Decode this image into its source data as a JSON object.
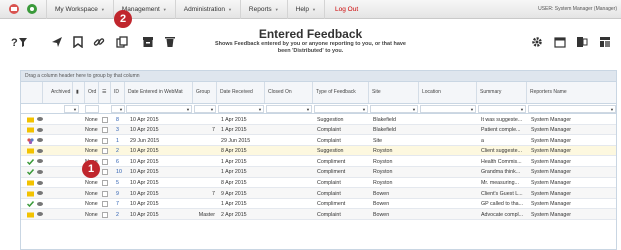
{
  "menubar": {
    "items": [
      {
        "label": "My Workspace"
      },
      {
        "label": "Management"
      },
      {
        "label": "Administration"
      },
      {
        "label": "Reports"
      },
      {
        "label": "Help"
      }
    ],
    "logout": "Log Out",
    "user": "USER: System Manager (Manager)"
  },
  "page": {
    "title": "Entered Feedback",
    "subtitle_line1": "Shows Feedback entered by you or anyone reporting to you, or that have",
    "subtitle_line2": "been 'Distributed' to you."
  },
  "badges": {
    "one": "1",
    "two": "2"
  },
  "grid": {
    "group_tip": "Drag a column header here to group by that column",
    "columns": [
      "Archived",
      "Ord",
      "ID",
      "Date Entered in WebMat",
      "Group",
      "Date Received",
      "Closed On",
      "Type of Feedback",
      "Site",
      "Location",
      "Summary",
      "Reporters Name"
    ],
    "rows": [
      {
        "flag": "yellow",
        "ord": "None",
        "id": "8",
        "entered": "10 Apr 2015",
        "group": "",
        "received": "1 Apr 2015",
        "type": "Suggestion",
        "site": "Blakefield",
        "summary": "It was suggeste...",
        "reporter": "System Manager"
      },
      {
        "flag": "yellow",
        "ord": "None",
        "id": "3",
        "entered": "10 Apr 2015",
        "group": "7",
        "received": "1 Apr 2015",
        "type": "Complaint",
        "site": "Blakefield",
        "summary": "Patient comple...",
        "reporter": "System Manager"
      },
      {
        "flag": "multi",
        "ord": "None",
        "id": "1",
        "entered": "29 Jun 2015",
        "group": "",
        "received": "29 Jun 2015",
        "type": "Complaint",
        "site": "Site",
        "summary": "a",
        "reporter": "System Manager"
      },
      {
        "flag": "yellow",
        "ord": "None",
        "id": "2",
        "entered": "10 Apr 2015",
        "group": "",
        "received": "8 Apr 2015",
        "type": "Suggestion",
        "site": "Royston",
        "summary": "Client suggeste...",
        "reporter": "System Manager"
      },
      {
        "flag": "check",
        "ord": "None",
        "id": "6",
        "entered": "10 Apr 2015",
        "group": "",
        "received": "1 Apr 2015",
        "type": "Compliment",
        "site": "Royston",
        "summary": "Health Commis...",
        "reporter": "System Manager"
      },
      {
        "flag": "check",
        "ord": "None",
        "id": "10",
        "entered": "10 Apr 2015",
        "group": "",
        "received": "1 Apr 2015",
        "type": "Compliment",
        "site": "Royston",
        "summary": "Grandma think...",
        "reporter": "System Manager"
      },
      {
        "flag": "yellow",
        "ord": "None",
        "id": "5",
        "entered": "10 Apr 2015",
        "group": "",
        "received": "8 Apr 2015",
        "type": "Complaint",
        "site": "Royston",
        "summary": "Mr. measuring...",
        "reporter": "System Manager"
      },
      {
        "flag": "yellow",
        "ord": "None",
        "id": "9",
        "entered": "10 Apr 2015",
        "group": "7",
        "received": "9 Apr 2015",
        "type": "Complaint",
        "site": "Bowen",
        "summary": "Client's Guest L...",
        "reporter": "System Manager"
      },
      {
        "flag": "check",
        "ord": "None",
        "id": "7",
        "entered": "10 Apr 2015",
        "group": "",
        "received": "1 Apr 2015",
        "type": "Compliment",
        "site": "Bowen",
        "summary": "GP called to tha...",
        "reporter": "System Manager"
      },
      {
        "flag": "yellow",
        "ord": "None",
        "id": "2",
        "entered": "10 Apr 2015",
        "group": "Master",
        "received": "2 Apr 2015",
        "type": "Complaint",
        "site": "Bowen",
        "summary": "Advocate compl...",
        "reporter": "System Manager"
      }
    ]
  },
  "colors": {
    "accent": "#2a5db0",
    "badge": "#c0262d",
    "logout": "#cc0000"
  }
}
